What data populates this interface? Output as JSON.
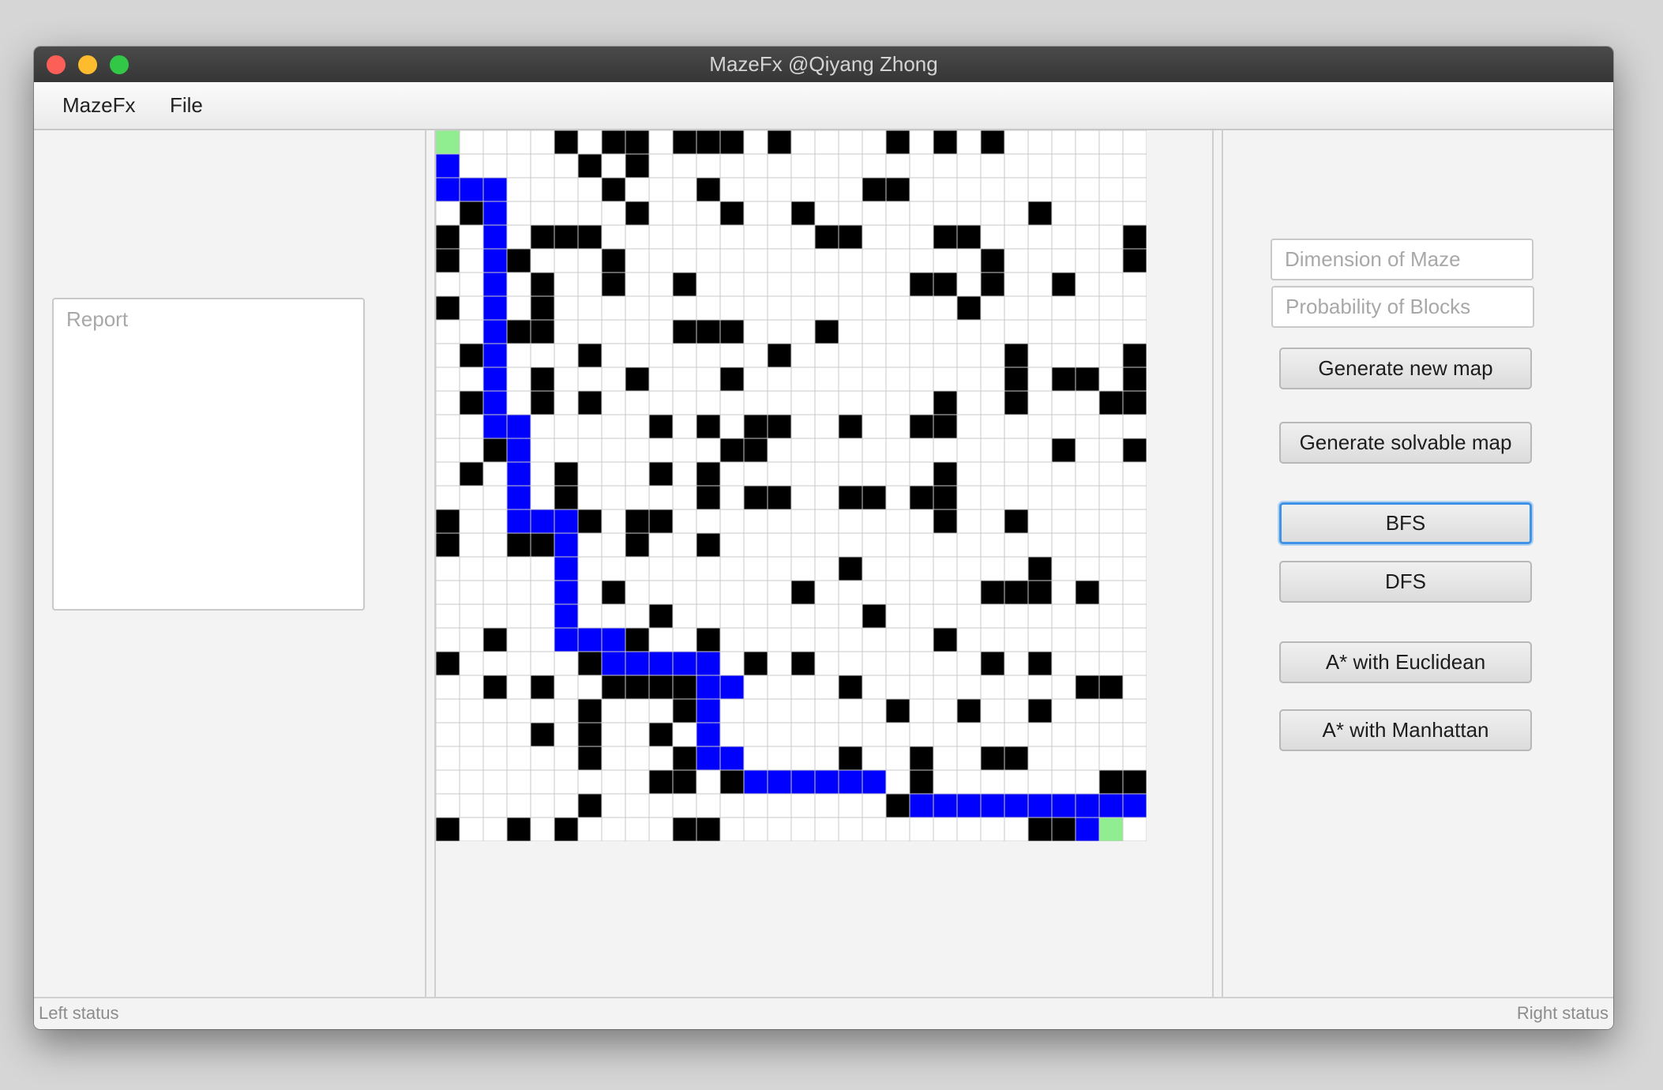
{
  "window": {
    "title": "MazeFx @Qiyang Zhong"
  },
  "menu": {
    "items": [
      "MazeFx",
      "File"
    ]
  },
  "left": {
    "report_placeholder": "Report"
  },
  "right": {
    "dimension_placeholder": "Dimension of Maze",
    "probability_placeholder": "Probability of Blocks",
    "buttons": {
      "generate_new": "Generate new map",
      "generate_solvable": "Generate solvable map",
      "bfs": "BFS",
      "dfs": "DFS",
      "astar_euclidean": "A* with Euclidean",
      "astar_manhattan": "A* with Manhattan"
    },
    "focused_button": "BFS"
  },
  "status": {
    "left": "Left status",
    "right": "Right status"
  },
  "maze": {
    "dimension": 30,
    "colors": {
      "empty": "#ffffff",
      "wall": "#000000",
      "path": "#0000ff",
      "endpoint": "#90ee90",
      "grid": "#c8c8c8"
    },
    "rows": [
      "S....#.##.###.#....#.#.#",
      "P.....#.#......................",
      "PPP....#...#......##.........",
      ".#P.....#...#..#.........#.....",
      "#.P.###.........##...##......#",
      "#.P#...#...............#.....#",
      "..P.#..#..#.........##.#..#...",
      "#.P.#.................#.....",
      "..P##.....###...#.............",
      ".#P...#.......#.........#....#",
      "..P.#...#...#...........#.##.#",
      ".#P.#.#..............#..#...###",
      "..PP.....#.#.##..#..##.......",
      "..#P........##............#..#.",
      ".#.P.#...#.#.........#..........",
      "...P.#.....#.##..##.##.........",
      "#..PPP#.##...........#..#......",
      "#..##P..#..#......................",
      ".....P...........#.......#..........",
      ".....P.#.......#.......###.#..#....",
      ".....P...#........#............#.#",
      "..#..PPP#..#.........#...........",
      "#.....#PPPPP.#.#.......#.#....#..",
      "..#.#..####PP....#.........##..#.",
      "......#...#P.......#..#..#.....",
      "....#.#..#.P.......................",
      "......#...#PP....#..#..##.........",
      ".........##.#PPPPPP.#.......##...",
      "......#............#PPPPPPPPPPPP.",
      "#..#.#....##.............##PE"
    ]
  }
}
